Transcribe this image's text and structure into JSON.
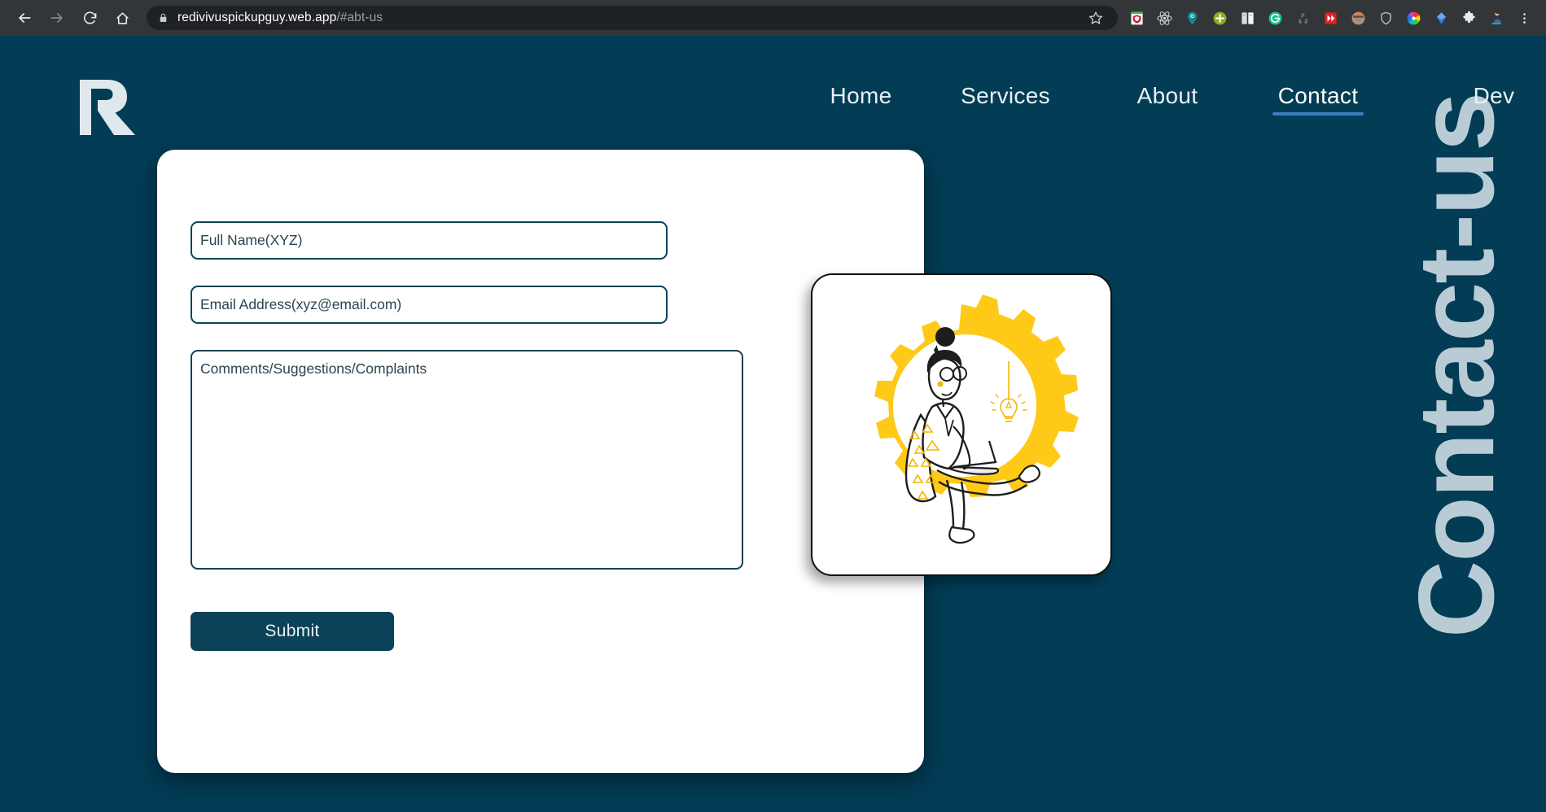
{
  "browser": {
    "back_icon": "back-arrow-icon",
    "forward_icon": "forward-arrow-icon",
    "reload_icon": "reload-icon",
    "home_icon": "home-icon",
    "lock_icon": "lock-icon",
    "url_domain": "redivivuspickupguy.web.app",
    "url_fragment": "/#abt-us",
    "star_icon": "bookmark-star-icon",
    "extensions": [
      {
        "name": "shield-red-extension-icon",
        "color": "#c8102e"
      },
      {
        "name": "react-devtools-extension-icon",
        "color": "#d8d8d8"
      },
      {
        "name": "location-pin-extension-icon",
        "color": "#0f8b8d"
      },
      {
        "name": "add-plus-extension-icon",
        "color": "#8aad1e"
      },
      {
        "name": "split-panels-extension-icon",
        "color": "#dcdcdc"
      },
      {
        "name": "grammarly-extension-icon",
        "color": "#15c39a"
      },
      {
        "name": "recycle-extension-icon",
        "color": "#6f7478"
      },
      {
        "name": "fast-forward-extension-icon",
        "color": "#e02020"
      },
      {
        "name": "avatar-glasses-extension-icon",
        "color": "#c98a5e"
      },
      {
        "name": "shield-outline-extension-icon",
        "color": "#b9bec2"
      },
      {
        "name": "color-wheel-extension-icon",
        "color": "#ff5a5f"
      },
      {
        "name": "blue-diamond-extension-icon",
        "color": "#2f7fe0"
      },
      {
        "name": "puzzle-piece-extension-icon",
        "color": "#e8eaed"
      },
      {
        "name": "profile-avatar-icon",
        "color": "#3b6fa0"
      },
      {
        "name": "chrome-menu-icon",
        "color": "#e8eaed"
      }
    ]
  },
  "site": {
    "background_color": "#023c55",
    "logo_name": "redivivus-r-logo",
    "watermark_text": "Contact-us",
    "watermark_color": "#b9ccd6",
    "nav": [
      {
        "label": "Home",
        "active": false
      },
      {
        "label": "Services",
        "active": false
      },
      {
        "label": "About",
        "active": false
      },
      {
        "label": "Contact",
        "active": true
      },
      {
        "label": "Dev",
        "active": false
      }
    ],
    "nav_active_underline_color": "#3b7dbf"
  },
  "contact_form": {
    "full_name": {
      "value": "",
      "placeholder": "Full Name(XYZ)"
    },
    "email": {
      "value": "",
      "placeholder": "Email Address(xyz@email.com)"
    },
    "comments": {
      "value": "",
      "placeholder": "Comments/Suggestions/Complaints"
    },
    "submit_label": "Submit",
    "submit_color": "#0c4257",
    "border_color": "#0c4257"
  },
  "illustration": {
    "name": "person-working-in-gear-illustration",
    "gear_color": "#FFC917",
    "accent_color": "#F2B705",
    "line_color": "#1d1d1b",
    "description": "Person with hair bun and glasses sitting inside a yellow gear working on a laptop with a hanging lightbulb"
  }
}
